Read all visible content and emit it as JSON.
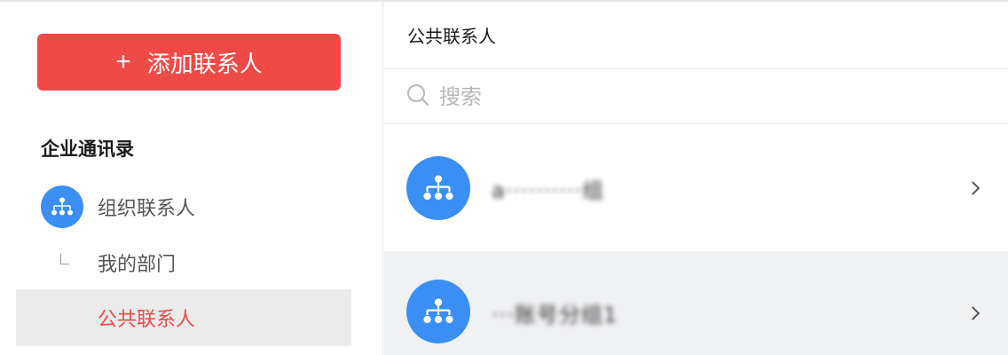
{
  "sidebar": {
    "add_button_label": "添加联系人",
    "section_title": "企业通讯录",
    "items": [
      {
        "label": "组织联系人",
        "icon": "org-chart-icon"
      },
      {
        "label": "我的部门"
      },
      {
        "label": "公共联系人",
        "selected": true
      }
    ]
  },
  "main": {
    "title": "公共联系人",
    "search_placeholder": "搜索",
    "groups": [
      {
        "name": "a··········组",
        "icon": "org-chart-icon",
        "redacted": true
      },
      {
        "name": "···账号分组1",
        "icon": "org-chart-icon",
        "redacted": true,
        "hovered": true
      }
    ]
  },
  "colors": {
    "accent": "#ef4a46",
    "avatar_blue": "#3a8ef4",
    "selected_bg": "#ebebeb",
    "hover_bg": "#f0f1f3"
  }
}
